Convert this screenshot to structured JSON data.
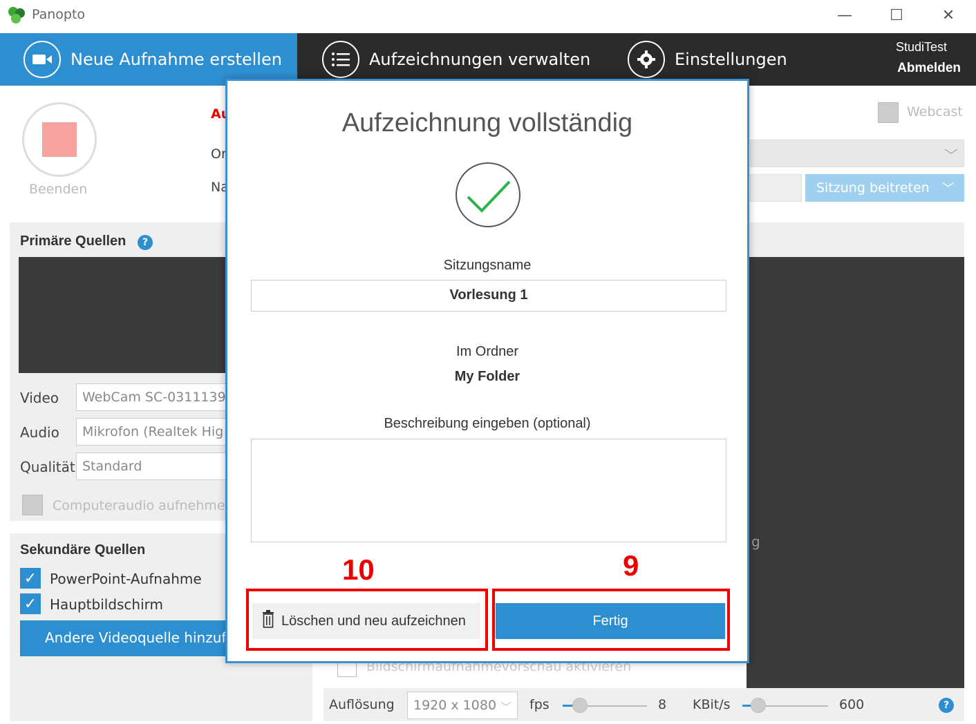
{
  "window": {
    "title": "Panopto",
    "icons": {
      "minimize": "minimize-icon",
      "maximize": "maximize-icon",
      "close": "close-icon"
    }
  },
  "nav": {
    "new_recording": "Neue Aufnahme erstellen",
    "manage_recordings": "Aufzeichnungen verwalten",
    "settings": "Einstellungen",
    "user": "StudiTest",
    "logout": "Abmelden"
  },
  "recording": {
    "stop_label": "Beenden",
    "partial_labels": [
      "Au",
      "Or",
      "Na"
    ],
    "webcast_label": "Webcast",
    "join_session": "Sitzung beitreten"
  },
  "primary_sources": {
    "title": "Primäre Quellen",
    "video_label": "Video",
    "video_value": "WebCam SC-0311139",
    "audio_label": "Audio",
    "audio_value": "Mikrofon (Realtek Hig",
    "quality_label": "Qualität",
    "quality_value": "Standard",
    "computer_audio": "Computeraudio aufnehme"
  },
  "secondary_sources": {
    "title": "Sekundäre Quellen",
    "items": [
      {
        "label": "PowerPoint-Aufnahme",
        "checked": true
      },
      {
        "label": "Hauptbildschirm",
        "checked": true
      }
    ],
    "add_source": "Andere Videoquelle hinzufü"
  },
  "bottom": {
    "preview_enable": "Bildschirmaufnahmevorschau aktivieren",
    "resolution_label": "Auflösung",
    "resolution_value": "1920 x 1080",
    "fps_label": "fps",
    "fps_value": "8",
    "kbits_label": "KBit/s",
    "kbits_value": "600",
    "stray_text": "g"
  },
  "modal": {
    "title": "Aufzeichnung vollständig",
    "session_name_label": "Sitzungsname",
    "session_name_value": "Vorlesung 1",
    "folder_label": "Im Ordner",
    "folder_value": "My Folder",
    "description_label": "Beschreibung eingeben (optional)",
    "description_value": "",
    "delete_button": "Löschen und neu aufzeichnen",
    "done_button": "Fertig",
    "annotation_delete": "10",
    "annotation_done": "9"
  },
  "colors": {
    "accent": "#2e8fd0",
    "navbar": "#2a2a2a",
    "annotation": "#e00000",
    "success": "#2db34a"
  }
}
